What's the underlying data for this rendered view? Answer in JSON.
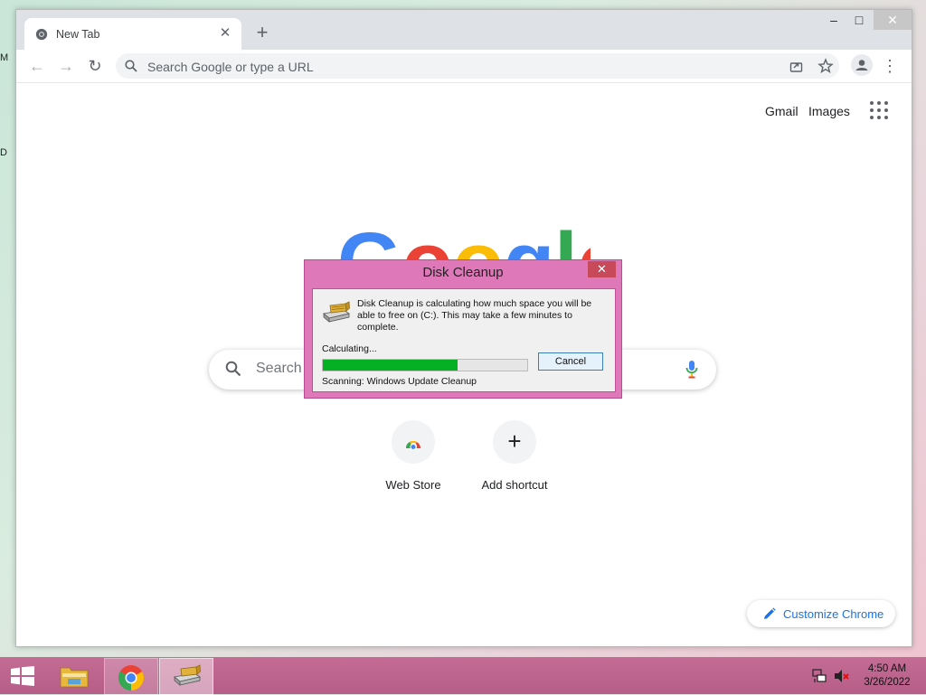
{
  "desktop": {
    "edge_labels": [
      "M",
      "D"
    ]
  },
  "window": {
    "controls": {
      "minimize": "–",
      "maximize": "□",
      "close": "✕"
    }
  },
  "tab": {
    "title": "New Tab",
    "close": "✕",
    "new_tab": "+"
  },
  "toolbar": {
    "back": "←",
    "forward": "→",
    "reload": "↻",
    "omnibox_placeholder": "Search Google or type a URL",
    "menu": "⋮"
  },
  "ntp": {
    "gmail": "Gmail",
    "images": "Images",
    "logo_letters": [
      {
        "char": "G",
        "color": "#4285f4"
      },
      {
        "char": "o",
        "color": "#ea4335"
      },
      {
        "char": "o",
        "color": "#fbbc05"
      },
      {
        "char": "g",
        "color": "#4285f4"
      },
      {
        "char": "l",
        "color": "#34a853"
      },
      {
        "char": "e",
        "color": "#ea4335"
      }
    ],
    "search_placeholder": "Search",
    "shortcuts": [
      {
        "label": "Web Store"
      },
      {
        "label": "Add shortcut",
        "symbol": "+"
      }
    ],
    "customize_label": "Customize Chrome"
  },
  "dialog": {
    "title": "Disk Cleanup",
    "close": "✕",
    "message": "Disk Cleanup is calculating how much space you will be able to free on  (C:). This may take a few minutes to complete.",
    "status": "Calculating...",
    "progress": 0.66,
    "cancel_label": "Cancel",
    "scanning": "Scanning:  Windows Update Cleanup"
  },
  "taskbar": {
    "time": "4:50 AM",
    "date": "3/26/2022"
  },
  "colors": {
    "accent_blue": "#1a73e8",
    "dialog_frame": "#df78b8",
    "progress_green": "#06b025",
    "taskbar": "#b65d88"
  }
}
